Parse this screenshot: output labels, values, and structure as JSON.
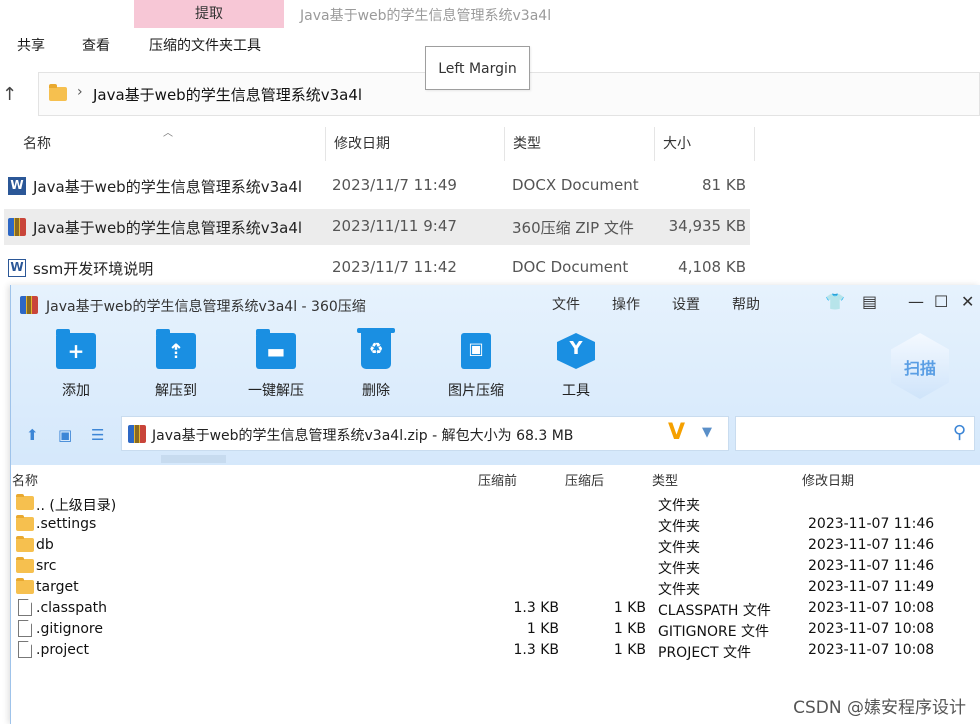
{
  "explorer": {
    "ribbon_active_tab": "提取",
    "window_title": "Java基于web的学生信息管理系统v3a4l",
    "menu": [
      "共享",
      "查看",
      "压缩的文件夹工具"
    ],
    "tooltip": "Left Margin",
    "address": "Java基于web的学生信息管理系统v3a4l",
    "columns": [
      "名称",
      "修改日期",
      "类型",
      "大小"
    ],
    "files": [
      {
        "name": "Java基于web的学生信息管理系统v3a4l",
        "date": "2023/11/7 11:49",
        "type": "DOCX Document",
        "size": "81 KB",
        "icon": "word-icon"
      },
      {
        "name": "Java基于web的学生信息管理系统v3a4l",
        "date": "2023/11/11 9:47",
        "type": "360压缩 ZIP 文件",
        "size": "34,935 KB",
        "icon": "zip-icon"
      },
      {
        "name": "ssm开发环境说明",
        "date": "2023/11/7 11:42",
        "type": "DOC Document",
        "size": "4,108 KB",
        "icon": "word-icon"
      }
    ]
  },
  "zip": {
    "title": "Java基于web的学生信息管理系统v3a4l - 360压缩",
    "menu": [
      "文件",
      "操作",
      "设置",
      "帮助"
    ],
    "tools": [
      "添加",
      "解压到",
      "一键解压",
      "删除",
      "图片压缩",
      "工具"
    ],
    "scan_label": "扫描",
    "path": "Java基于web的学生信息管理系统v3a4l.zip - 解包大小为 68.3 MB",
    "columns": [
      "名称",
      "压缩前",
      "压缩后",
      "类型",
      "修改日期"
    ],
    "rows": [
      {
        "name": ".. (上级目录)",
        "orig": "",
        "comp": "",
        "type": "文件夹",
        "date": "",
        "kind": "folder"
      },
      {
        "name": ".settings",
        "orig": "",
        "comp": "",
        "type": "文件夹",
        "date": "2023-11-07 11:46",
        "kind": "folder"
      },
      {
        "name": "db",
        "orig": "",
        "comp": "",
        "type": "文件夹",
        "date": "2023-11-07 11:46",
        "kind": "folder"
      },
      {
        "name": "src",
        "orig": "",
        "comp": "",
        "type": "文件夹",
        "date": "2023-11-07 11:46",
        "kind": "folder"
      },
      {
        "name": "target",
        "orig": "",
        "comp": "",
        "type": "文件夹",
        "date": "2023-11-07 11:49",
        "kind": "folder"
      },
      {
        "name": ".classpath",
        "orig": "1.3 KB",
        "comp": "1 KB",
        "type": "CLASSPATH 文件",
        "date": "2023-11-07 10:08",
        "kind": "file"
      },
      {
        "name": ".gitignore",
        "orig": "1 KB",
        "comp": "1 KB",
        "type": "GITIGNORE 文件",
        "date": "2023-11-07 10:08",
        "kind": "file"
      },
      {
        "name": ".project",
        "orig": "1.3 KB",
        "comp": "1 KB",
        "type": "PROJECT 文件",
        "date": "2023-11-07 10:08",
        "kind": "file"
      }
    ]
  },
  "watermark": "CSDN @嫊安程序设计",
  "colors": {
    "accent": "#1a8fe2",
    "zip_header": "#dcecfc",
    "ribbon_tab": "#f7c7d6"
  }
}
